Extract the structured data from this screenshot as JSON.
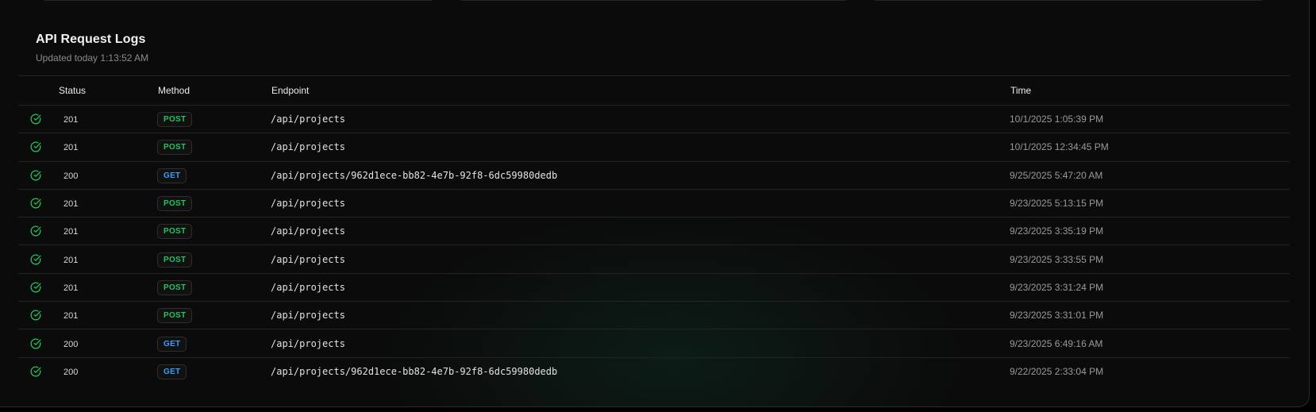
{
  "panel": {
    "title": "API Request Logs",
    "subtitle": "Updated today 1:13:52 AM"
  },
  "table": {
    "columns": {
      "status": "Status",
      "method": "Method",
      "endpoint": "Endpoint",
      "time": "Time"
    },
    "rows": [
      {
        "status": "201",
        "method": "POST",
        "endpoint": "/api/projects",
        "time": "10/1/2025 1:05:39 PM"
      },
      {
        "status": "201",
        "method": "POST",
        "endpoint": "/api/projects",
        "time": "10/1/2025 12:34:45 PM"
      },
      {
        "status": "200",
        "method": "GET",
        "endpoint": "/api/projects/962d1ece-bb82-4e7b-92f8-6dc59980dedb",
        "time": "9/25/2025 5:47:20 AM"
      },
      {
        "status": "201",
        "method": "POST",
        "endpoint": "/api/projects",
        "time": "9/23/2025 5:13:15 PM"
      },
      {
        "status": "201",
        "method": "POST",
        "endpoint": "/api/projects",
        "time": "9/23/2025 3:35:19 PM"
      },
      {
        "status": "201",
        "method": "POST",
        "endpoint": "/api/projects",
        "time": "9/23/2025 3:33:55 PM"
      },
      {
        "status": "201",
        "method": "POST",
        "endpoint": "/api/projects",
        "time": "9/23/2025 3:31:24 PM"
      },
      {
        "status": "201",
        "method": "POST",
        "endpoint": "/api/projects",
        "time": "9/23/2025 3:31:01 PM"
      },
      {
        "status": "200",
        "method": "GET",
        "endpoint": "/api/projects",
        "time": "9/23/2025 6:49:16 AM"
      },
      {
        "status": "200",
        "method": "GET",
        "endpoint": "/api/projects/962d1ece-bb82-4e7b-92f8-6dc59980dedb",
        "time": "9/22/2025 2:33:04 PM"
      }
    ],
    "status_icon": "check-circle-icon"
  },
  "colors": {
    "success": "#22c55e",
    "post": "#22c55e",
    "get": "#3b9eff",
    "background": "#0b0b0b"
  }
}
